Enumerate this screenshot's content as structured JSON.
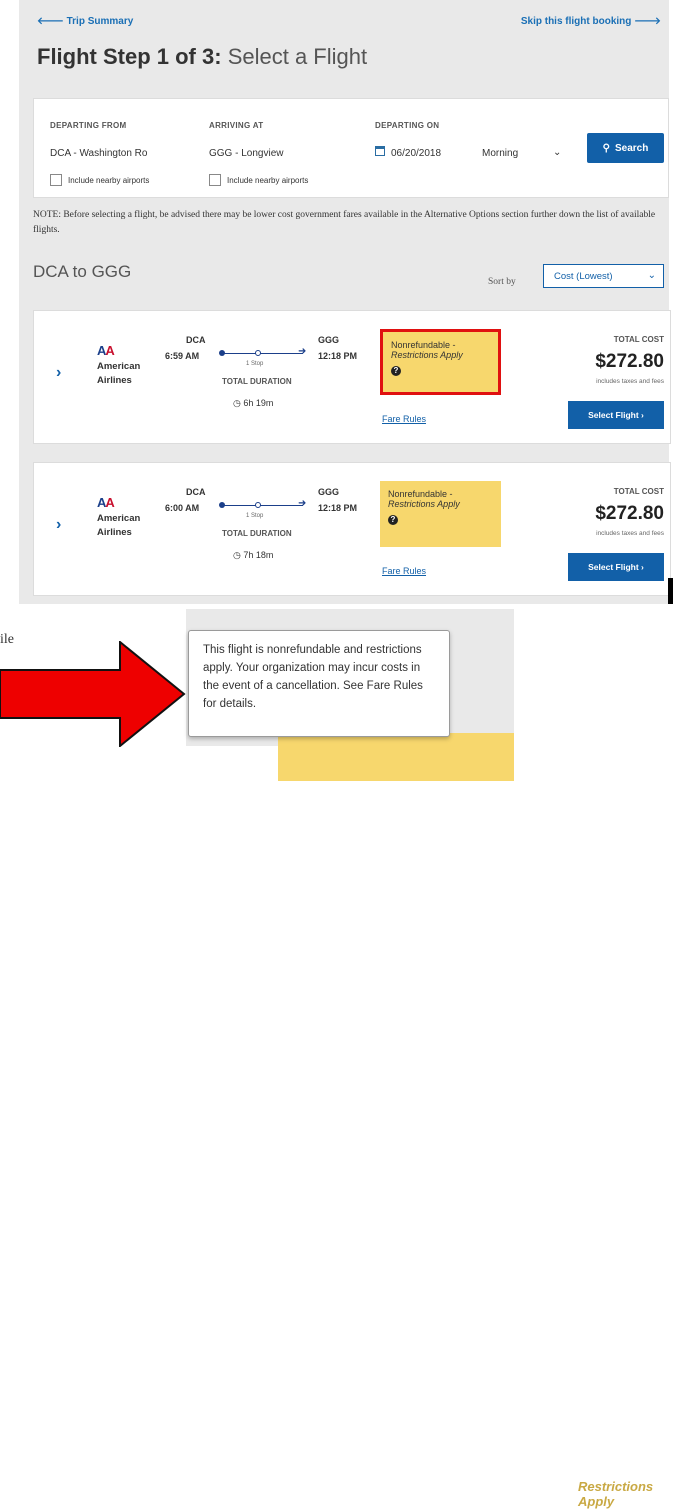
{
  "nav": {
    "back_label": "Trip Summary",
    "skip_label": "Skip this flight booking"
  },
  "page": {
    "title_bold": "Flight Step 1 of 3:",
    "title_rest": "Select a Flight"
  },
  "search": {
    "departing_label": "DEPARTING FROM",
    "departing_value": "DCA - Washington Ro",
    "arriving_label": "ARRIVING AT",
    "arriving_value": "GGG - Longview",
    "date_label": "DEPARTING ON",
    "date_value": "06/20/2018",
    "time_value": "Morning",
    "nearby_label": "Include nearby airports",
    "button_label": "Search"
  },
  "note": "NOTE: Before selecting a flight, be advised there may be lower cost government fares available in the Alternative Options section further down the list of available flights.",
  "results": {
    "route": "DCA to GGG",
    "sort_label": "Sort by",
    "sort_value": "Cost (Lowest)"
  },
  "flights": [
    {
      "airline": "American Airlines",
      "depart_code": "DCA",
      "depart_time": "6:59 AM",
      "arrive_code": "GGG",
      "arrive_time": "12:18 PM",
      "stops": "1 Stop",
      "duration_label": "TOTAL DURATION",
      "duration": "6h 19m",
      "restriction_title": "Nonrefundable -",
      "restriction_sub": "Restrictions Apply",
      "fare_rules": "Fare Rules",
      "total_label": "TOTAL COST",
      "total": "$272.80",
      "total_sub": "includes taxes and fees",
      "select_label": "Select Flight ›"
    },
    {
      "airline": "American Airlines",
      "depart_code": "DCA",
      "depart_time": "6:00 AM",
      "arrive_code": "GGG",
      "arrive_time": "12:18 PM",
      "stops": "1 Stop",
      "duration_label": "TOTAL DURATION",
      "duration": "7h 18m",
      "restriction_title": "Nonrefundable -",
      "restriction_sub": "Restrictions Apply",
      "fare_rules": "Fare Rules",
      "total_label": "TOTAL COST",
      "total": "$272.80",
      "total_sub": "includes taxes and fees",
      "select_label": "Select Flight ›"
    }
  ],
  "tooltip": {
    "text": "This flight is nonrefundable and restrictions apply. Your organization may incur costs in the event of a cancellation. See Fare Rules for details.",
    "background_text": "Restrictions Apply"
  },
  "partial_text": "ile",
  "colors": {
    "accent_blue": "#1260a8",
    "restriction_yellow": "#f7d76d",
    "highlight_red": "#e01010",
    "arrow_red": "#ee0000"
  },
  "icons": [
    "arrow-left-icon",
    "arrow-right-icon",
    "calendar-icon",
    "chevron-down-icon",
    "search-icon",
    "expand-chevron-icon",
    "american-airlines-logo",
    "plane-icon",
    "clock-icon",
    "question-icon",
    "big-red-arrow-icon"
  ]
}
